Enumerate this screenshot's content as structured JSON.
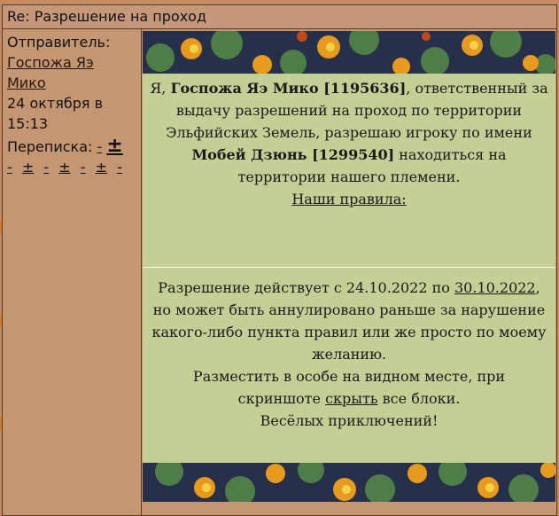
{
  "header": {
    "title": "Re: Разрешение на проход"
  },
  "sidebar": {
    "sender_label": "Отправитель:",
    "sender_name": "Госпожа Яэ Мико",
    "date_line1": "24 октября в",
    "date_line2": "15:13",
    "conversation_label": "Переписка:",
    "conv_minus": "-",
    "conv_plus": "±",
    "conv_row": [
      "-",
      "±",
      "-",
      "±",
      "-",
      "±",
      "-"
    ]
  },
  "permit": {
    "p1_a": "Я, ",
    "p1_name": "Госпожа Яэ Мико [1195636]",
    "p1_b": ", ответственный за выдачу разрешений на проход по территории Эльфийских Земель, разрешаю игроку по имени ",
    "p1_player": "Мобей Дзюнь [1299540]",
    "p1_c": " находиться на территории нашего племени.",
    "rules_link": "Наши правила:",
    "p2_a": "Разрешение действует с 24.10.2022 по ",
    "p2_date": "30.10.2022",
    "p2_b": ", но может быть аннулировано раньше за нарушение какого-либо пункта правил или же просто по моему желанию.",
    "p3_a": "Разместить в особе на видном месте, при скриншоте ",
    "p3_link": "скрыть",
    "p3_b": " все блоки.",
    "p4": "Весёлых приключений!"
  },
  "colors": {
    "page_bg": "#c48a62",
    "panel_bg": "#c4cf96",
    "flower_bg": "#26304a",
    "border": "#5a3a22"
  },
  "icons": [
    "nasturtium-flower-banner"
  ]
}
